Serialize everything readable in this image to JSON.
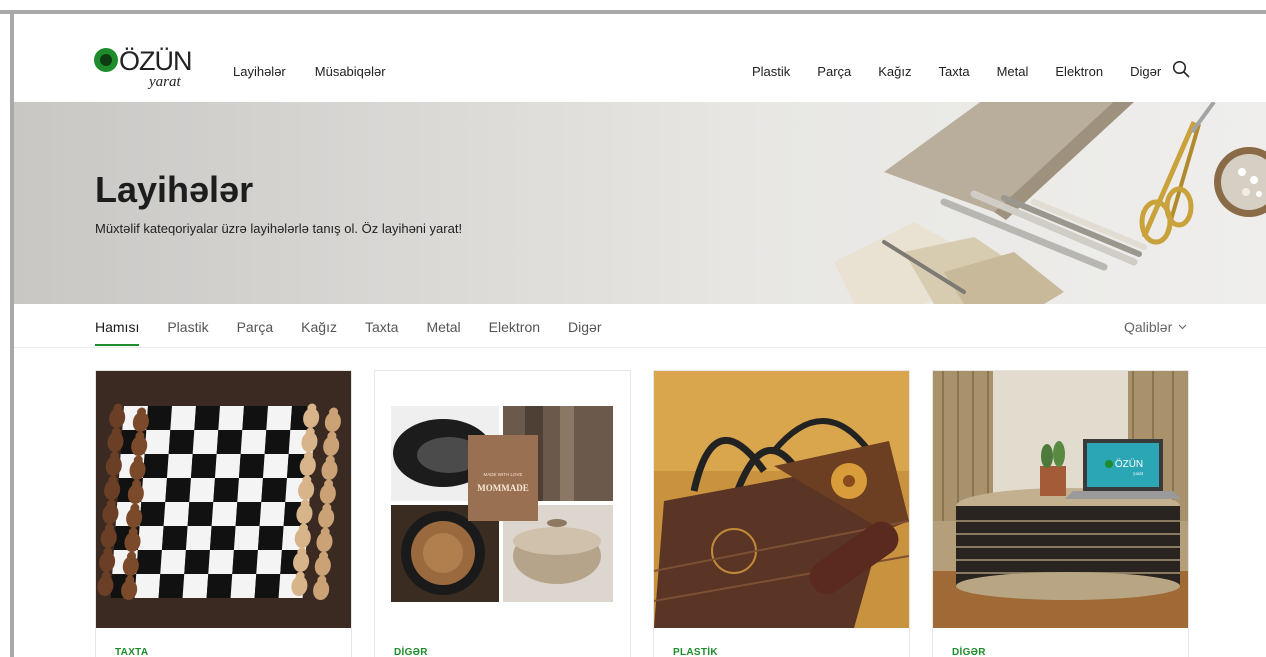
{
  "logo": {
    "word": "ÖZÜN",
    "sub": "yarat"
  },
  "nav_left": [
    "Layihələr",
    "Müsabiqələr"
  ],
  "nav_right": [
    "Plastik",
    "Parça",
    "Kağız",
    "Taxta",
    "Metal",
    "Elektron",
    "Digər"
  ],
  "hero": {
    "title": "Layihələr",
    "subtitle": "Müxtəlif kateqoriyalar üzrə layihələrlə tanış ol. Öz layihəni yarat!"
  },
  "filters": {
    "tabs": [
      "Hamısı",
      "Plastik",
      "Parça",
      "Kağız",
      "Taxta",
      "Metal",
      "Elektron",
      "Digər"
    ],
    "active": "Hamısı",
    "templates_label": "Qaliblər"
  },
  "cards": [
    {
      "category": "TAXTA",
      "image": "chess-board"
    },
    {
      "category": "DİGƏR",
      "image": "tire-collage",
      "collage_label_1": "MADE WITH LOVE",
      "collage_label_2": "MOMMADE"
    },
    {
      "category": "PLASTİK",
      "image": "handbag-bottle"
    },
    {
      "category": "DİGƏR",
      "image": "tire-table-laptop",
      "laptop_logo": "ÖZÜN",
      "laptop_sub": "yarat"
    }
  ],
  "colors": {
    "accent": "#1f8c2c",
    "frame": "#a9a9a9"
  }
}
